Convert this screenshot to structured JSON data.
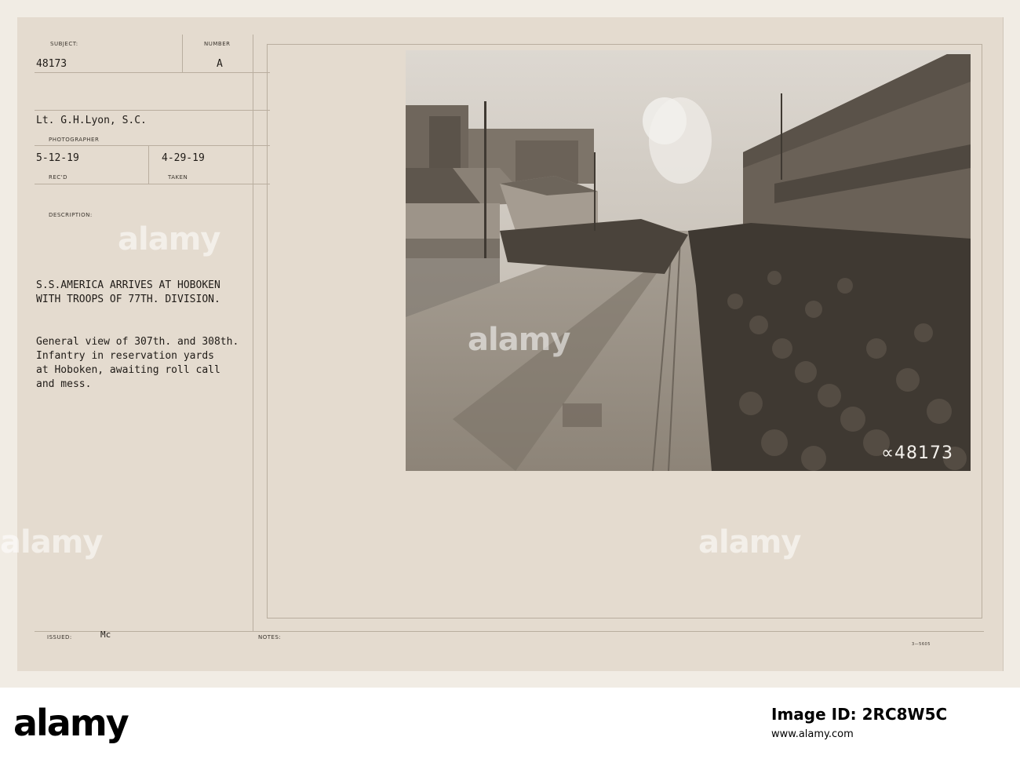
{
  "card": {
    "subject_label": "SUBJECT:",
    "subject_value": "48173",
    "number_label": "NUMBER",
    "number_value": "A",
    "photographer_value": "Lt. G.H.Lyon, S.C.",
    "photographer_label": "PHOTOGRAPHER",
    "recd_value": "5-12-19",
    "recd_label": "REC'D",
    "taken_value": "4-29-19",
    "taken_label": "TAKEN",
    "description_label": "DESCRIPTION:",
    "title_line1": "S.S.AMERICA ARRIVES AT HOBOKEN",
    "title_line2": "WITH TROOPS OF 77TH. DIVISION.",
    "desc_line1": "General view of 307th. and 308th.",
    "desc_line2": "Infantry in reservation yards",
    "desc_line3": "at Hoboken, awaiting roll call",
    "desc_line4": "and mess.",
    "issued_label": "ISSUED:",
    "issued_value": "Mc",
    "notes_label": "NOTES:",
    "form_number": "3—5605",
    "photo_number": "48173"
  },
  "watermarks": [
    "alamy",
    "alamy",
    "alamy",
    "alamy"
  ],
  "footer": {
    "logo": "alamy",
    "image_id": "Image ID: 2RC8W5C",
    "url": "www.alamy.com"
  }
}
